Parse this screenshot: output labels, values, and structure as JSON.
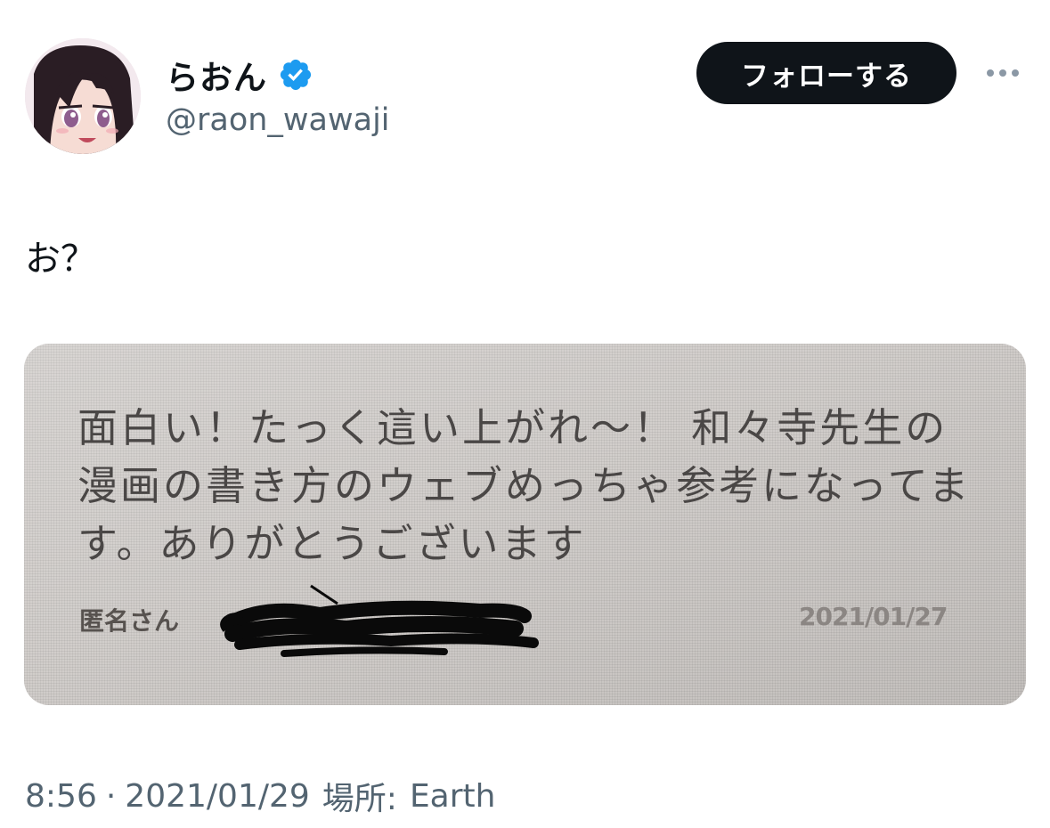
{
  "user": {
    "display_name": "らおん",
    "handle": "@raon_wawaji",
    "verified_icon": "verified-badge-icon",
    "avatar": "anime-girl-avatar"
  },
  "actions": {
    "follow_label": "フォローする",
    "more_icon": "more-dots-icon"
  },
  "tweet": {
    "text": "お？"
  },
  "photo": {
    "message_text": "面白い！たっく這い上がれ〜！ 和々寺先生の漫画の書き方のウェブめっちゃ参考になってます。ありがとうございます",
    "sender": "匿名さん",
    "date": "2021/01/27"
  },
  "meta": {
    "time": "8:56",
    "separator": "·",
    "date": "2021/01/29",
    "location_label": "場所:",
    "location": "Earth"
  },
  "colors": {
    "follow_button_bg": "#0f1419",
    "verified_blue": "#1d9bf0",
    "secondary_text": "#536471"
  }
}
